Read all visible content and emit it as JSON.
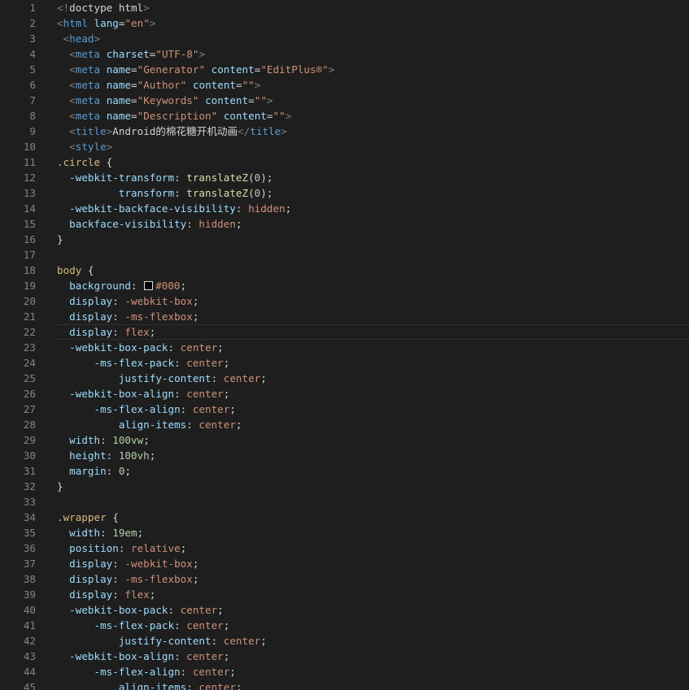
{
  "editor": {
    "active_line": 22,
    "lines": [
      {
        "n": "1",
        "tokens": [
          [
            "punct",
            "<!"
          ],
          [
            "text",
            "doctype html"
          ],
          [
            "punct",
            ">"
          ]
        ]
      },
      {
        "n": "2",
        "tokens": [
          [
            "punct",
            "<"
          ],
          [
            "tag",
            "html"
          ],
          [
            "plain",
            " "
          ],
          [
            "attr",
            "lang"
          ],
          [
            "plain",
            "="
          ],
          [
            "str",
            "\"en\""
          ],
          [
            "punct",
            ">"
          ]
        ]
      },
      {
        "n": "3",
        "tokens": [
          [
            "plain",
            " "
          ],
          [
            "punct",
            "<"
          ],
          [
            "tag",
            "head"
          ],
          [
            "punct",
            ">"
          ]
        ]
      },
      {
        "n": "4",
        "tokens": [
          [
            "plain",
            "  "
          ],
          [
            "punct",
            "<"
          ],
          [
            "tag",
            "meta"
          ],
          [
            "plain",
            " "
          ],
          [
            "attr",
            "charset"
          ],
          [
            "plain",
            "="
          ],
          [
            "str",
            "\"UTF-8\""
          ],
          [
            "punct",
            ">"
          ]
        ]
      },
      {
        "n": "5",
        "tokens": [
          [
            "plain",
            "  "
          ],
          [
            "punct",
            "<"
          ],
          [
            "tag",
            "meta"
          ],
          [
            "plain",
            " "
          ],
          [
            "attr",
            "name"
          ],
          [
            "plain",
            "="
          ],
          [
            "str",
            "\"Generator\""
          ],
          [
            "plain",
            " "
          ],
          [
            "attr",
            "content"
          ],
          [
            "plain",
            "="
          ],
          [
            "str",
            "\"EditPlus®\""
          ],
          [
            "punct",
            ">"
          ]
        ]
      },
      {
        "n": "6",
        "tokens": [
          [
            "plain",
            "  "
          ],
          [
            "punct",
            "<"
          ],
          [
            "tag",
            "meta"
          ],
          [
            "plain",
            " "
          ],
          [
            "attr",
            "name"
          ],
          [
            "plain",
            "="
          ],
          [
            "str",
            "\"Author\""
          ],
          [
            "plain",
            " "
          ],
          [
            "attr",
            "content"
          ],
          [
            "plain",
            "="
          ],
          [
            "str",
            "\"\""
          ],
          [
            "punct",
            ">"
          ]
        ]
      },
      {
        "n": "7",
        "tokens": [
          [
            "plain",
            "  "
          ],
          [
            "punct",
            "<"
          ],
          [
            "tag",
            "meta"
          ],
          [
            "plain",
            " "
          ],
          [
            "attr",
            "name"
          ],
          [
            "plain",
            "="
          ],
          [
            "str",
            "\"Keywords\""
          ],
          [
            "plain",
            " "
          ],
          [
            "attr",
            "content"
          ],
          [
            "plain",
            "="
          ],
          [
            "str",
            "\"\""
          ],
          [
            "punct",
            ">"
          ]
        ]
      },
      {
        "n": "8",
        "tokens": [
          [
            "plain",
            "  "
          ],
          [
            "punct",
            "<"
          ],
          [
            "tag",
            "meta"
          ],
          [
            "plain",
            " "
          ],
          [
            "attr",
            "name"
          ],
          [
            "plain",
            "="
          ],
          [
            "str",
            "\"Description\""
          ],
          [
            "plain",
            " "
          ],
          [
            "attr",
            "content"
          ],
          [
            "plain",
            "="
          ],
          [
            "str",
            "\"\""
          ],
          [
            "punct",
            ">"
          ]
        ]
      },
      {
        "n": "9",
        "tokens": [
          [
            "plain",
            "  "
          ],
          [
            "punct",
            "<"
          ],
          [
            "tag",
            "title"
          ],
          [
            "punct",
            ">"
          ],
          [
            "text",
            "Android的棉花糖开机动画"
          ],
          [
            "punct",
            "</"
          ],
          [
            "tag",
            "title"
          ],
          [
            "punct",
            ">"
          ]
        ]
      },
      {
        "n": "10",
        "tokens": [
          [
            "plain",
            "  "
          ],
          [
            "punct",
            "<"
          ],
          [
            "tag",
            "style"
          ],
          [
            "punct",
            ">"
          ]
        ]
      },
      {
        "n": "11",
        "tokens": [
          [
            "sel",
            ".circle"
          ],
          [
            "plain",
            " {"
          ]
        ]
      },
      {
        "n": "12",
        "tokens": [
          [
            "plain",
            "  "
          ],
          [
            "prop",
            "-webkit-transform"
          ],
          [
            "plain",
            ": "
          ],
          [
            "fn",
            "translateZ"
          ],
          [
            "plain",
            "("
          ],
          [
            "num",
            "0"
          ],
          [
            "plain",
            ");"
          ]
        ]
      },
      {
        "n": "13",
        "tokens": [
          [
            "plain",
            "          "
          ],
          [
            "prop",
            "transform"
          ],
          [
            "plain",
            ": "
          ],
          [
            "fn",
            "translateZ"
          ],
          [
            "plain",
            "("
          ],
          [
            "num",
            "0"
          ],
          [
            "plain",
            ");"
          ]
        ]
      },
      {
        "n": "14",
        "tokens": [
          [
            "plain",
            "  "
          ],
          [
            "prop",
            "-webkit-backface-visibility"
          ],
          [
            "plain",
            ": "
          ],
          [
            "val",
            "hidden"
          ],
          [
            "plain",
            ";"
          ]
        ]
      },
      {
        "n": "15",
        "tokens": [
          [
            "plain",
            "  "
          ],
          [
            "prop",
            "backface-visibility"
          ],
          [
            "plain",
            ": "
          ],
          [
            "val",
            "hidden"
          ],
          [
            "plain",
            ";"
          ]
        ]
      },
      {
        "n": "16",
        "tokens": [
          [
            "plain",
            "}"
          ]
        ]
      },
      {
        "n": "17",
        "tokens": []
      },
      {
        "n": "18",
        "tokens": [
          [
            "sel",
            "body"
          ],
          [
            "plain",
            " {"
          ]
        ]
      },
      {
        "n": "19",
        "tokens": [
          [
            "plain",
            "  "
          ],
          [
            "prop",
            "background"
          ],
          [
            "plain",
            ": "
          ],
          [
            "swatch",
            ""
          ],
          [
            "val",
            "#000"
          ],
          [
            "plain",
            ";"
          ]
        ]
      },
      {
        "n": "20",
        "tokens": [
          [
            "plain",
            "  "
          ],
          [
            "prop",
            "display"
          ],
          [
            "plain",
            ": "
          ],
          [
            "val",
            "-webkit-box"
          ],
          [
            "plain",
            ";"
          ]
        ]
      },
      {
        "n": "21",
        "tokens": [
          [
            "plain",
            "  "
          ],
          [
            "prop",
            "display"
          ],
          [
            "plain",
            ": "
          ],
          [
            "val",
            "-ms-flexbox"
          ],
          [
            "plain",
            ";"
          ]
        ]
      },
      {
        "n": "22",
        "tokens": [
          [
            "plain",
            "  "
          ],
          [
            "prop",
            "display"
          ],
          [
            "plain",
            ": "
          ],
          [
            "val",
            "flex"
          ],
          [
            "plain",
            ";"
          ]
        ]
      },
      {
        "n": "23",
        "tokens": [
          [
            "plain",
            "  "
          ],
          [
            "prop",
            "-webkit-box-pack"
          ],
          [
            "plain",
            ": "
          ],
          [
            "val",
            "center"
          ],
          [
            "plain",
            ";"
          ]
        ]
      },
      {
        "n": "24",
        "tokens": [
          [
            "plain",
            "      "
          ],
          [
            "prop",
            "-ms-flex-pack"
          ],
          [
            "plain",
            ": "
          ],
          [
            "val",
            "center"
          ],
          [
            "plain",
            ";"
          ]
        ]
      },
      {
        "n": "25",
        "tokens": [
          [
            "plain",
            "          "
          ],
          [
            "prop",
            "justify-content"
          ],
          [
            "plain",
            ": "
          ],
          [
            "val",
            "center"
          ],
          [
            "plain",
            ";"
          ]
        ]
      },
      {
        "n": "26",
        "tokens": [
          [
            "plain",
            "  "
          ],
          [
            "prop",
            "-webkit-box-align"
          ],
          [
            "plain",
            ": "
          ],
          [
            "val",
            "center"
          ],
          [
            "plain",
            ";"
          ]
        ]
      },
      {
        "n": "27",
        "tokens": [
          [
            "plain",
            "      "
          ],
          [
            "prop",
            "-ms-flex-align"
          ],
          [
            "plain",
            ": "
          ],
          [
            "val",
            "center"
          ],
          [
            "plain",
            ";"
          ]
        ]
      },
      {
        "n": "28",
        "tokens": [
          [
            "plain",
            "          "
          ],
          [
            "prop",
            "align-items"
          ],
          [
            "plain",
            ": "
          ],
          [
            "val",
            "center"
          ],
          [
            "plain",
            ";"
          ]
        ]
      },
      {
        "n": "29",
        "tokens": [
          [
            "plain",
            "  "
          ],
          [
            "prop",
            "width"
          ],
          [
            "plain",
            ": "
          ],
          [
            "num",
            "100vw"
          ],
          [
            "plain",
            ";"
          ]
        ]
      },
      {
        "n": "30",
        "tokens": [
          [
            "plain",
            "  "
          ],
          [
            "prop",
            "height"
          ],
          [
            "plain",
            ": "
          ],
          [
            "num",
            "100vh"
          ],
          [
            "plain",
            ";"
          ]
        ]
      },
      {
        "n": "31",
        "tokens": [
          [
            "plain",
            "  "
          ],
          [
            "prop",
            "margin"
          ],
          [
            "plain",
            ": "
          ],
          [
            "num",
            "0"
          ],
          [
            "plain",
            ";"
          ]
        ]
      },
      {
        "n": "32",
        "tokens": [
          [
            "plain",
            "}"
          ]
        ]
      },
      {
        "n": "33",
        "tokens": []
      },
      {
        "n": "34",
        "tokens": [
          [
            "sel",
            ".wrapper"
          ],
          [
            "plain",
            " {"
          ]
        ]
      },
      {
        "n": "35",
        "tokens": [
          [
            "plain",
            "  "
          ],
          [
            "prop",
            "width"
          ],
          [
            "plain",
            ": "
          ],
          [
            "num",
            "19em"
          ],
          [
            "plain",
            ";"
          ]
        ]
      },
      {
        "n": "36",
        "tokens": [
          [
            "plain",
            "  "
          ],
          [
            "prop",
            "position"
          ],
          [
            "plain",
            ": "
          ],
          [
            "val",
            "relative"
          ],
          [
            "plain",
            ";"
          ]
        ]
      },
      {
        "n": "37",
        "tokens": [
          [
            "plain",
            "  "
          ],
          [
            "prop",
            "display"
          ],
          [
            "plain",
            ": "
          ],
          [
            "val",
            "-webkit-box"
          ],
          [
            "plain",
            ";"
          ]
        ]
      },
      {
        "n": "38",
        "tokens": [
          [
            "plain",
            "  "
          ],
          [
            "prop",
            "display"
          ],
          [
            "plain",
            ": "
          ],
          [
            "val",
            "-ms-flexbox"
          ],
          [
            "plain",
            ";"
          ]
        ]
      },
      {
        "n": "39",
        "tokens": [
          [
            "plain",
            "  "
          ],
          [
            "prop",
            "display"
          ],
          [
            "plain",
            ": "
          ],
          [
            "val",
            "flex"
          ],
          [
            "plain",
            ";"
          ]
        ]
      },
      {
        "n": "40",
        "tokens": [
          [
            "plain",
            "  "
          ],
          [
            "prop",
            "-webkit-box-pack"
          ],
          [
            "plain",
            ": "
          ],
          [
            "val",
            "center"
          ],
          [
            "plain",
            ";"
          ]
        ]
      },
      {
        "n": "41",
        "tokens": [
          [
            "plain",
            "      "
          ],
          [
            "prop",
            "-ms-flex-pack"
          ],
          [
            "plain",
            ": "
          ],
          [
            "val",
            "center"
          ],
          [
            "plain",
            ";"
          ]
        ]
      },
      {
        "n": "42",
        "tokens": [
          [
            "plain",
            "          "
          ],
          [
            "prop",
            "justify-content"
          ],
          [
            "plain",
            ": "
          ],
          [
            "val",
            "center"
          ],
          [
            "plain",
            ";"
          ]
        ]
      },
      {
        "n": "43",
        "tokens": [
          [
            "plain",
            "  "
          ],
          [
            "prop",
            "-webkit-box-align"
          ],
          [
            "plain",
            ": "
          ],
          [
            "val",
            "center"
          ],
          [
            "plain",
            ";"
          ]
        ]
      },
      {
        "n": "44",
        "tokens": [
          [
            "plain",
            "      "
          ],
          [
            "prop",
            "-ms-flex-align"
          ],
          [
            "plain",
            ": "
          ],
          [
            "val",
            "center"
          ],
          [
            "plain",
            ";"
          ]
        ]
      },
      {
        "n": "45",
        "tokens": [
          [
            "plain",
            "          "
          ],
          [
            "prop",
            "align-items"
          ],
          [
            "plain",
            ": "
          ],
          [
            "val",
            "center"
          ],
          [
            "plain",
            ";"
          ]
        ]
      }
    ]
  }
}
